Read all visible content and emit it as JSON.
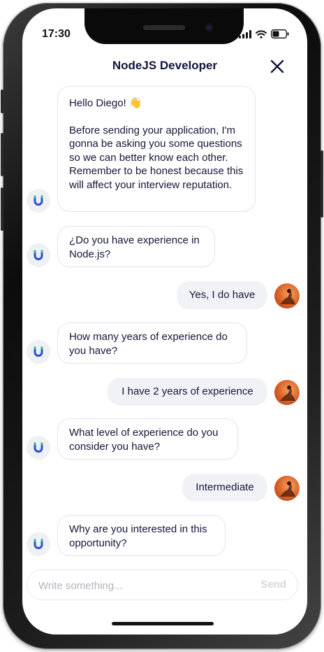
{
  "status_bar": {
    "time": "17:30"
  },
  "header": {
    "title": "NodeJS Developer"
  },
  "messages": [
    {
      "from": "bot",
      "paragraphs": [
        "Hello Diego! 👋",
        "Before sending your application, I'm gonna be asking you some questions so we can better know each other. Remember to be honest because this will affect your interview reputation."
      ]
    },
    {
      "from": "bot",
      "text": "¿Do you have experience in Node.js?"
    },
    {
      "from": "user",
      "text": "Yes, I do have"
    },
    {
      "from": "bot",
      "text": "How many years of experience do you have?"
    },
    {
      "from": "user",
      "text": "I have 2 years of experience"
    },
    {
      "from": "bot",
      "text": "What level of experience do you consider you have?"
    },
    {
      "from": "user",
      "text": "Intermediate"
    },
    {
      "from": "bot",
      "text": "Why are you interested in this opportunity?"
    }
  ],
  "composer": {
    "placeholder": "Write something...",
    "send_label": "Send"
  },
  "icons": {
    "close": "close-icon",
    "bot_logo": "magnet-icon",
    "signal": "signal-icon",
    "wifi": "wifi-icon",
    "battery": "battery-icon"
  },
  "colors": {
    "bot_logo": "#2a4fd8",
    "bot_logo_accent": "#22c38e",
    "title": "#12143a",
    "bubble_border": "#e3e4ec",
    "user_bubble": "#f1f2f6"
  }
}
